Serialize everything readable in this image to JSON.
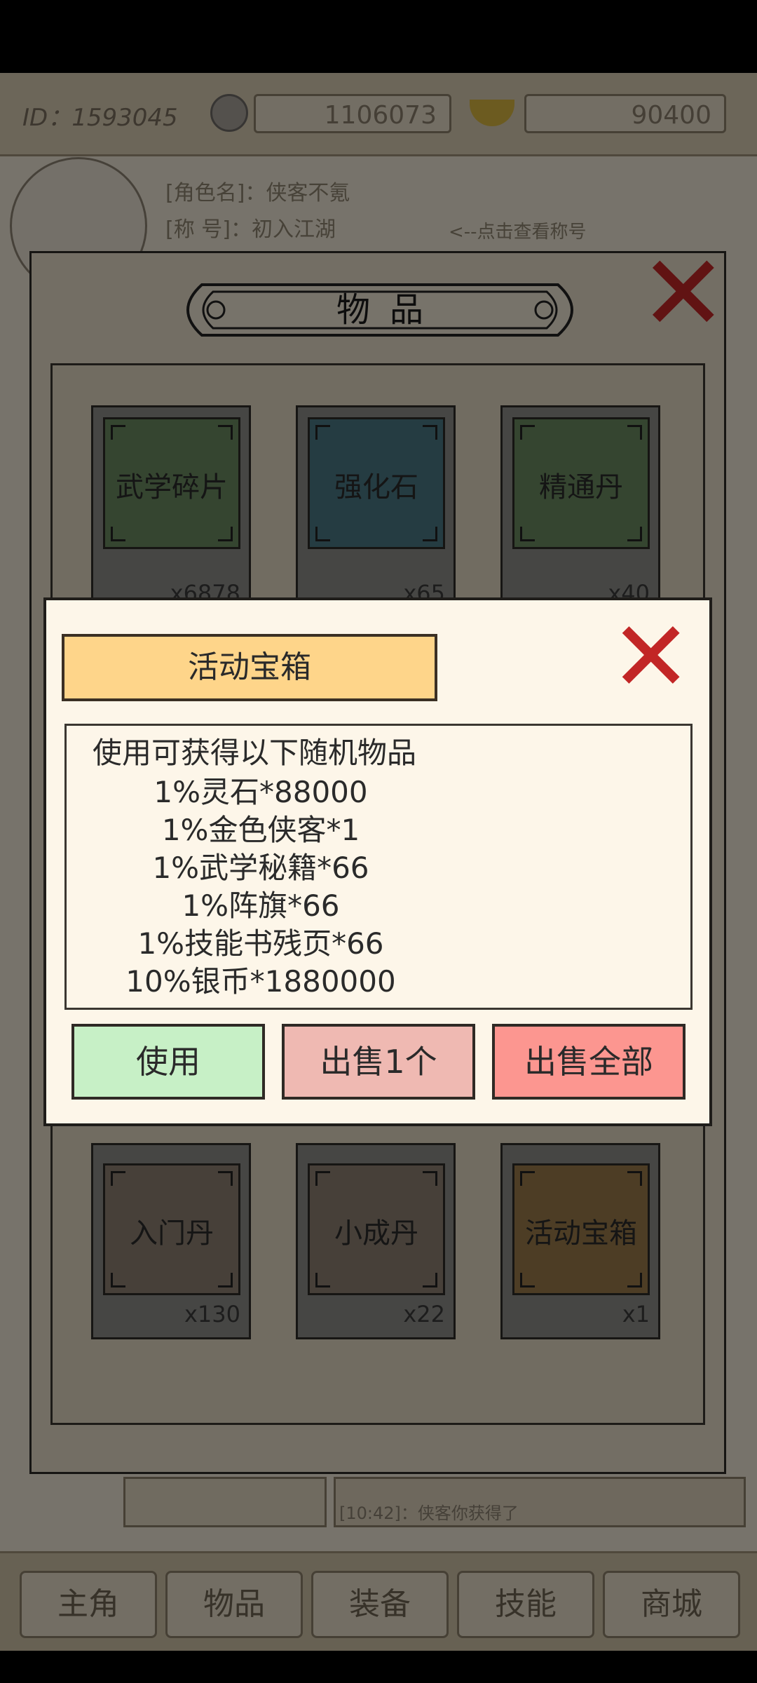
{
  "hud": {
    "id_text": "ID：1593045",
    "currency1": "1106073",
    "currency2": "90400"
  },
  "profile": {
    "role_name": "[角色名]：侠客不氪",
    "title": "[称  号]：初入江湖",
    "hint": "<--点击查看称号"
  },
  "items_window": {
    "title": "物品",
    "items": [
      {
        "name": "武学碎片",
        "qty": "x6878",
        "color": "#5f7f55"
      },
      {
        "name": "强化石",
        "qty": "x65",
        "color": "#3f6b76"
      },
      {
        "name": "精通丹",
        "qty": "x40",
        "color": "#5f7f55"
      },
      {
        "name": "入门丹",
        "qty": "x130",
        "color": "#837466"
      },
      {
        "name": "小成丹",
        "qty": "x22",
        "color": "#837466"
      },
      {
        "name": "活动宝箱",
        "qty": "x1",
        "color": "#8e6d40"
      }
    ]
  },
  "popup": {
    "title": "活动宝箱",
    "header": "使用可获得以下随机物品",
    "rewards": [
      "1%灵石*88000",
      "1%金色侠客*1",
      "1%武学秘籍*66",
      "1%阵旗*66",
      "1%技能书残页*66",
      "10%银币*1880000"
    ],
    "buttons": {
      "use": "使用",
      "sell_one": "出售1个",
      "sell_all": "出售全部"
    },
    "colors": {
      "title_bg": "#fed58a",
      "use_bg": "#c7f0c6",
      "sell_one_bg": "#efb9b2",
      "sell_all_bg": "#fc9690",
      "close": "#c22626"
    }
  },
  "nav": [
    "主角",
    "物品",
    "装备",
    "技能",
    "商城"
  ],
  "log": {
    "line1": "[10:42]：",
    "line2": "[10:42]：侠客你获得了"
  }
}
